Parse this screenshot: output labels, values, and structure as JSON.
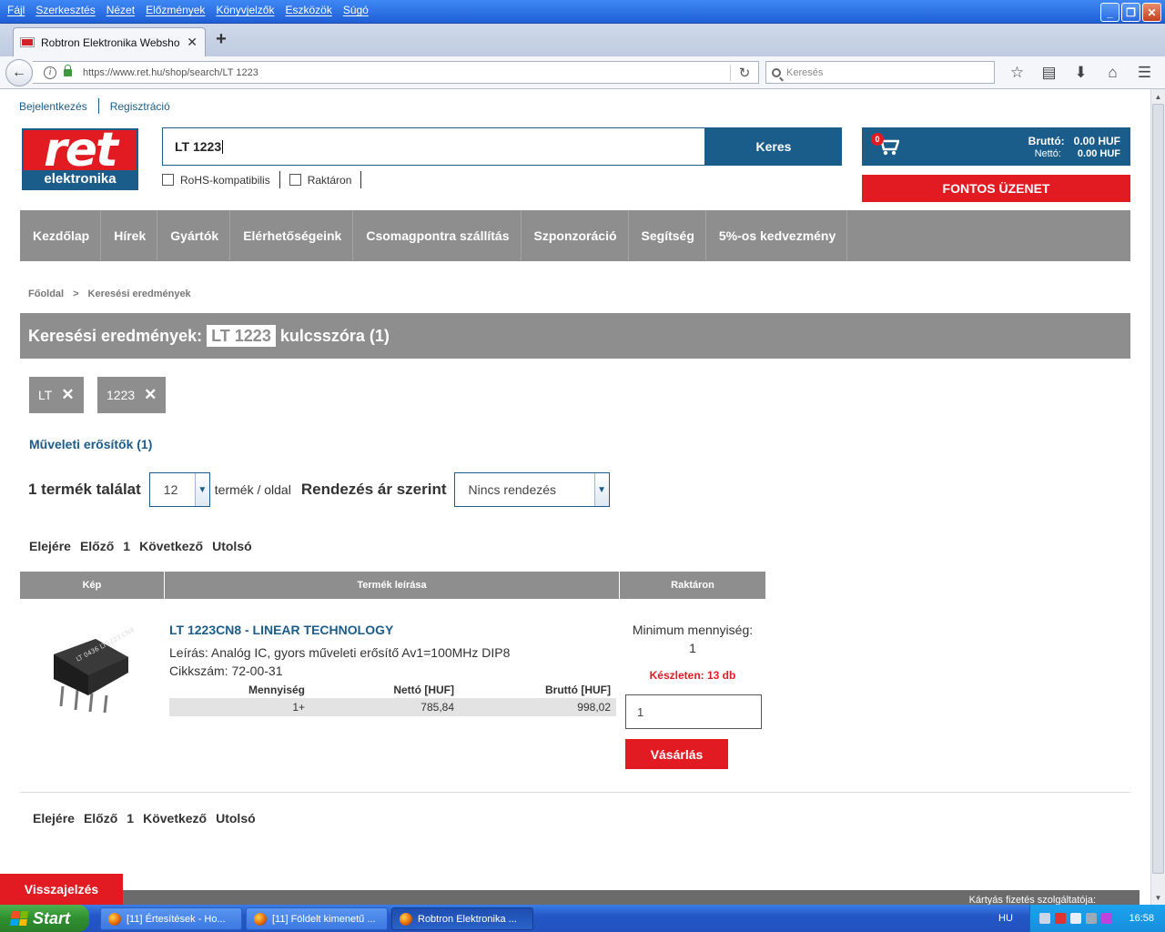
{
  "browser": {
    "menu": [
      "Fájl",
      "Szerkesztés",
      "Nézet",
      "Előzmények",
      "Könyvjelzők",
      "Eszközök",
      "Súgó"
    ],
    "tab_title": "Robtron Elektronika Webshop",
    "url": "https://www.ret.hu/shop/search/LT 1223",
    "search_placeholder": "Keresés",
    "window_buttons": [
      "minimize-icon",
      "restore-icon",
      "close-icon"
    ],
    "toolbar_icons": [
      "bookmark-star-icon",
      "reading-list-icon",
      "download-icon",
      "home-icon",
      "hamburger-menu-icon"
    ]
  },
  "site": {
    "top_links": {
      "login": "Bejelentkezés",
      "register": "Regisztráció"
    },
    "logo": {
      "top": "ret",
      "bottom": "elektronika"
    },
    "search": {
      "value": "LT 1223",
      "button": "Keres"
    },
    "filters": {
      "rohs": "RoHS-kompatibilis",
      "in_stock": "Raktáron"
    },
    "cart": {
      "count": "0",
      "brutto_label": "Bruttó:",
      "brutto_value": "0.00 HUF",
      "netto_label": "Nettó:",
      "netto_value": "0.00 HUF"
    },
    "notice_button": "FONTOS ÜZENET",
    "nav": [
      "Kezdőlap",
      "Hírek",
      "Gyártók",
      "Elérhetőségeink",
      "Csomagpontra szállítás",
      "Szponzoráció",
      "Segítség",
      "5%-os kedvezmény"
    ],
    "breadcrumb": {
      "home": "Főoldal",
      "sep": ">",
      "current": "Keresési eredmények"
    },
    "results_header": {
      "prefix": "Keresési eredmények:",
      "keyword": "LT 1223",
      "suffix": "kulcsszóra (1)"
    },
    "tags": [
      "LT",
      "1223"
    ],
    "category_link": "Műveleti erősítők (1)",
    "listing": {
      "count": "1 termék találat",
      "per_page_value": "12",
      "per_page_label": "termék / oldal",
      "sort_label": "Rendezés ár szerint",
      "sort_value": "Nincs rendezés"
    },
    "pager": {
      "first": "Elejére",
      "prev": "Előző",
      "page": "1",
      "next": "Következő",
      "last": "Utolsó"
    },
    "table_headers": {
      "image": "Kép",
      "description": "Termék leírása",
      "stock": "Raktáron"
    },
    "product": {
      "title": "LT 1223CN8 - LINEAR TECHNOLOGY",
      "description": "Leírás: Analóg IC, gyors műveleti erősítő Av1=100MHz DIP8",
      "code": "Cikkszám: 72-00-31",
      "price_headers": {
        "qty": "Mennyiség",
        "net": "Nettó [HUF]",
        "gross": "Bruttó [HUF]"
      },
      "price_rows": [
        {
          "qty": "1+",
          "net": "785,84",
          "gross": "998,02"
        }
      ],
      "min_qty_label": "Minimum mennyiség:",
      "min_qty_value": "1",
      "stock": "Készleten: 13 db",
      "qty_value": "1",
      "buy_button": "Vásárlás",
      "chip_marking": "LT 0436 LT1223 CN8"
    },
    "feedback": "Visszajelzés",
    "card_payment": "Kártyás fizetés szolgáltatója:"
  },
  "taskbar": {
    "start": "Start",
    "tasks": [
      {
        "label": "[11] Értesítések - Ho..."
      },
      {
        "label": "[11] Földelt kimenetű ..."
      },
      {
        "label": "Robtron Elektronika ..."
      }
    ],
    "language": "HU",
    "clock": "16:58"
  },
  "colors": {
    "brand_blue": "#1b5d8a",
    "brand_red": "#e21b23",
    "nav_gray": "#8e8e8e"
  }
}
